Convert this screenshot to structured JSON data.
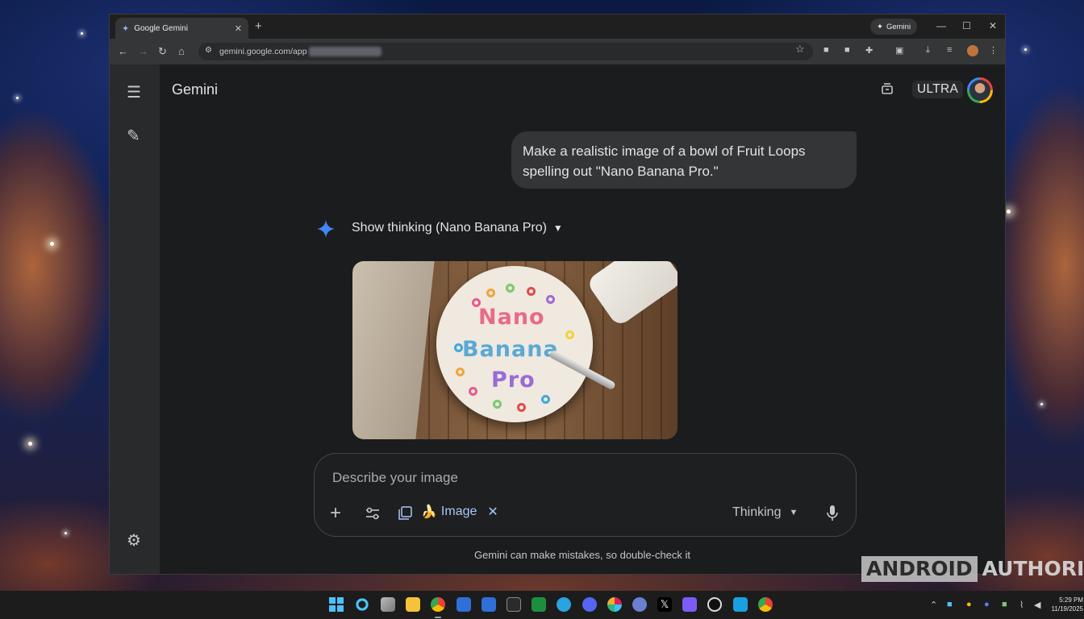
{
  "browser": {
    "tab_title": "Google Gemini",
    "new_tab_icon": "plus-icon",
    "gemini_chip_label": "Gemini",
    "url": "gemini.google.com/app",
    "window_controls": [
      "minimize-icon",
      "maximize-icon",
      "close-icon"
    ]
  },
  "app": {
    "title": "Gemini",
    "plan_badge": "ULTRA"
  },
  "chat": {
    "user_message": "Make a realistic image of a bowl of Fruit Loops spelling out \"Nano Banana Pro.\"",
    "thinking_label": "Show thinking (Nano Banana Pro)",
    "image_text": [
      "Nano",
      "Banana",
      "Pro"
    ]
  },
  "composer": {
    "placeholder": "Describe your image",
    "tool_chip_label": "Image",
    "tool_chip_emoji": "🍌",
    "mode_label": "Thinking"
  },
  "footer": {
    "disclaimer": "Gemini can make mistakes, so double-check it"
  },
  "watermark": {
    "part1": "ANDROID",
    "part2": "AUTHORITY"
  },
  "taskbar": {
    "time": "5:29 PM",
    "date": "11/19/2025"
  },
  "colors": {
    "accent_blue": "#a8c7fa",
    "gemini_spark": "#4285f4",
    "app_bg": "#1b1c1d",
    "bubble_bg": "#333537"
  }
}
